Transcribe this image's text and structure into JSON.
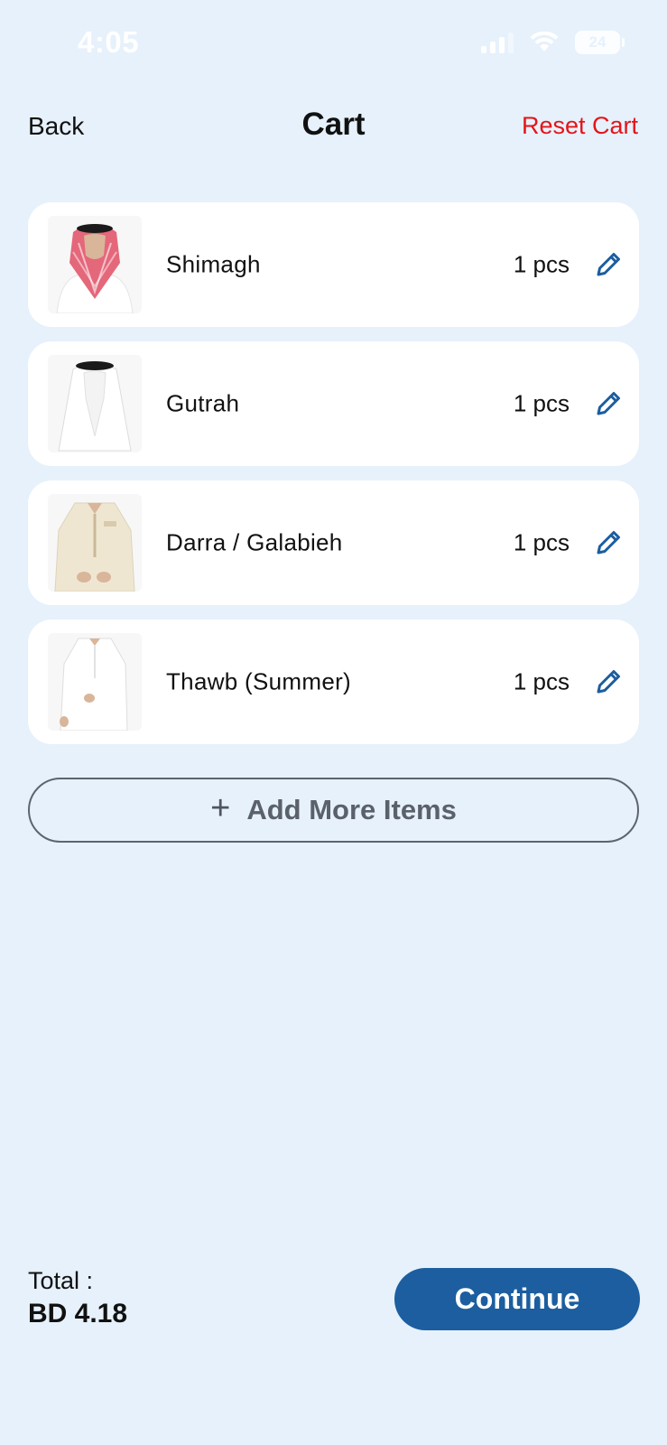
{
  "status_bar": {
    "time": "4:05",
    "battery": "24"
  },
  "header": {
    "back_label": "Back",
    "title": "Cart",
    "reset_label": "Reset Cart"
  },
  "cart": {
    "items": [
      {
        "name": "Shimagh",
        "quantity": "1 pcs",
        "image": "shimagh-image"
      },
      {
        "name": "Gutrah",
        "quantity": "1 pcs",
        "image": "gutrah-image"
      },
      {
        "name": "Darra / Galabieh",
        "quantity": "1 pcs",
        "image": "darra-image"
      },
      {
        "name": "Thawb (Summer)",
        "quantity": "1 pcs",
        "image": "thawb-image"
      }
    ],
    "edit_icon": "pencil-icon"
  },
  "add_more": {
    "icon": "plus-icon",
    "label": "Add More Items"
  },
  "footer": {
    "total_label": "Total :",
    "total_value": "BD 4.18",
    "continue_label": "Continue"
  },
  "colors": {
    "background": "#e6f1fb",
    "accent": "#1c5e9f",
    "reset": "#e3151a",
    "card": "#ffffff"
  }
}
